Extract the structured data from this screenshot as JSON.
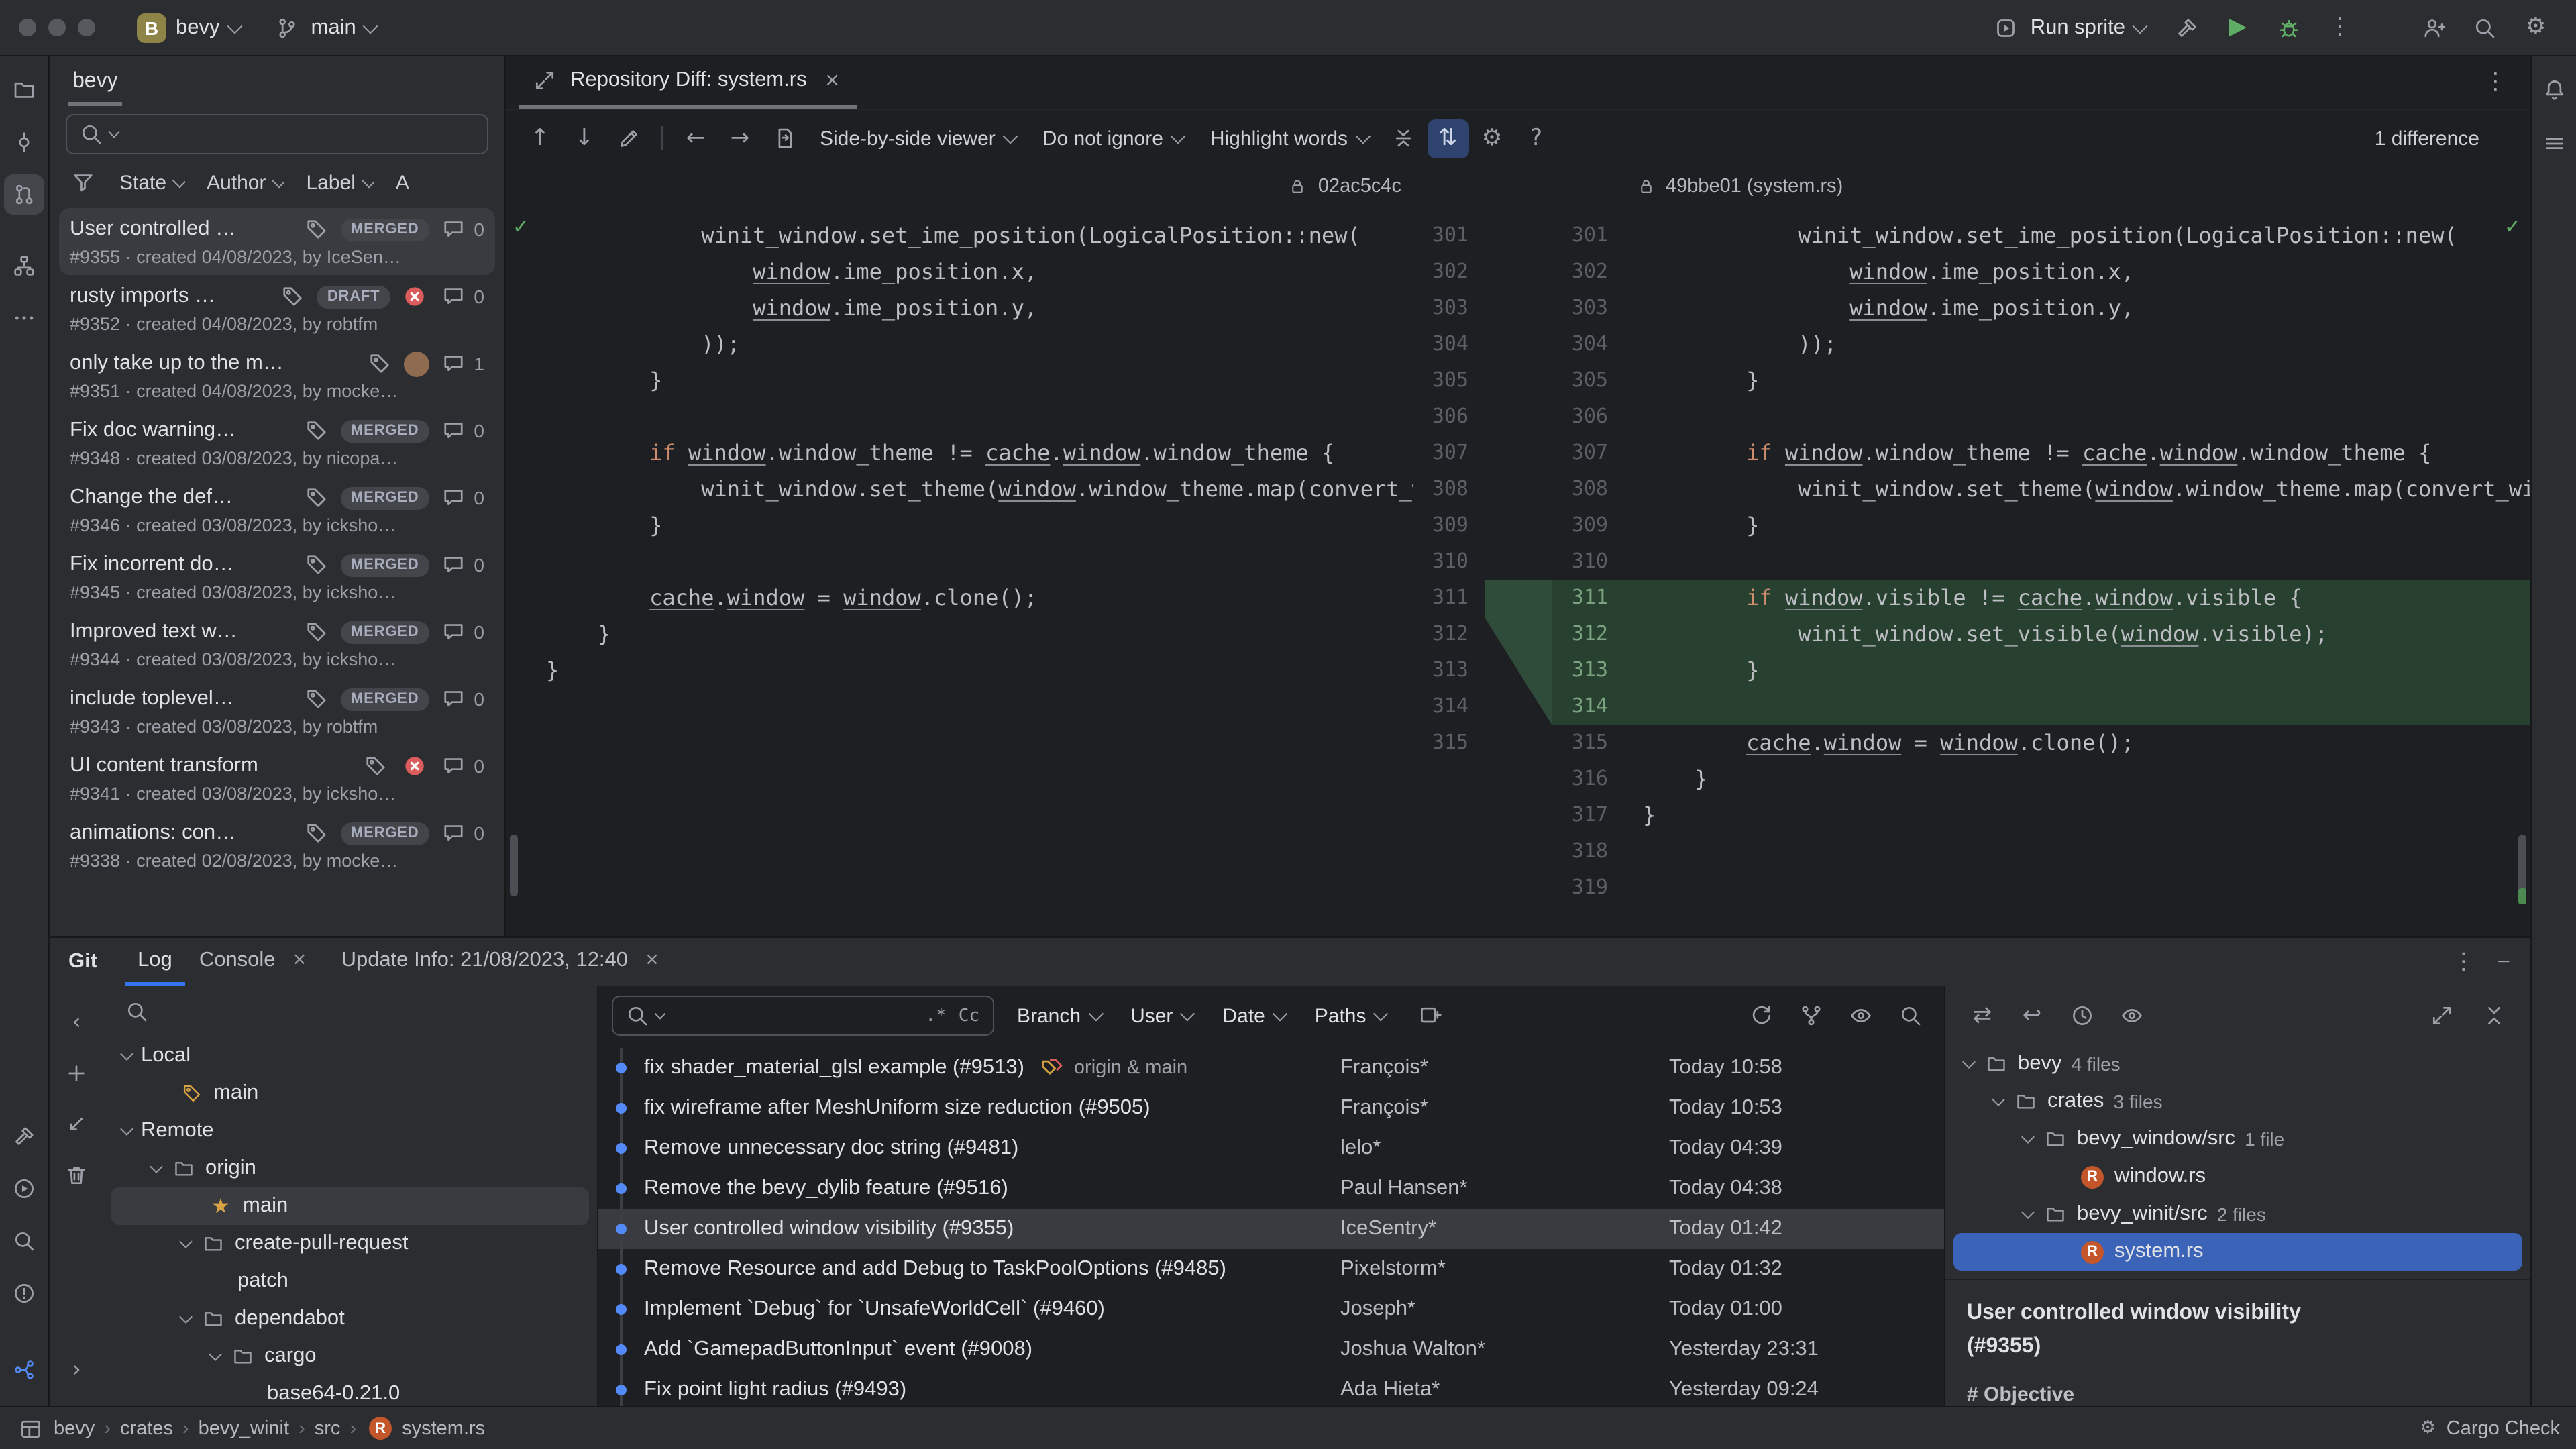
{
  "colors": {
    "accent_blue": "#3574F0",
    "selection_focused": "#3B63B8",
    "selection_unfocused": "#393B40",
    "diff_added_bg": "#28402F",
    "run_green": "#5FAD65",
    "error_red": "#DB5C5C",
    "star_yellow": "#D9A343"
  },
  "topbar": {
    "project": "bevy",
    "project_initial": "B",
    "branch": "main",
    "run_config": "Run sprite"
  },
  "left_stripe": {
    "top": [
      {
        "name": "project-icon",
        "active": false
      },
      {
        "name": "commit-icon",
        "active": false
      },
      {
        "name": "pull-requests-icon",
        "active": true
      },
      {
        "name": "structure-icon",
        "active": false,
        "extra": "mt14"
      },
      {
        "name": "more-tools-icon",
        "active": false
      }
    ],
    "bottom": [
      {
        "name": "build-icon"
      },
      {
        "name": "services-icon"
      },
      {
        "name": "find-icon"
      },
      {
        "name": "problems-icon"
      },
      {
        "name": "version-control-icon",
        "accent": true,
        "extra": "mt18"
      }
    ]
  },
  "right_stripe": [
    "notifications-icon",
    "right-stripe-icon"
  ],
  "pr_panel": {
    "tab_label": "bevy",
    "filters": [
      {
        "label": "State",
        "chevron": true
      },
      {
        "label": "Author",
        "chevron": true
      },
      {
        "label": "Label",
        "chevron": true
      },
      {
        "label": "A",
        "chevron": false
      }
    ],
    "items": [
      {
        "title": "User controlled …",
        "tag": true,
        "badge": "MERGED",
        "comments": "0",
        "meta": "#9355 · created 04/08/2023, by IceSen…",
        "selected": true
      },
      {
        "title": "rusty imports …",
        "tag": true,
        "badge": "DRAFT",
        "failed": true,
        "comments": "0",
        "meta": "#9352 · created 04/08/2023, by robtfm"
      },
      {
        "title": "only take up to the m…",
        "tag": true,
        "avatar": true,
        "comments": "1",
        "meta": "#9351 · created 04/08/2023, by mocke…"
      },
      {
        "title": "Fix doc warning…",
        "tag": true,
        "badge": "MERGED",
        "comments": "0",
        "meta": "#9348 · created 03/08/2023, by nicopa…"
      },
      {
        "title": "Change the def…",
        "tag": true,
        "badge": "MERGED",
        "comments": "0",
        "meta": "#9346 · created 03/08/2023, by icksho…"
      },
      {
        "title": "Fix incorrent do…",
        "tag": true,
        "badge": "MERGED",
        "comments": "0",
        "meta": "#9345 · created 03/08/2023, by icksho…"
      },
      {
        "title": "Improved text w…",
        "tag": true,
        "badge": "MERGED",
        "comments": "0",
        "meta": "#9344 · created 03/08/2023, by icksho…"
      },
      {
        "title": "include toplevel…",
        "tag": true,
        "badge": "MERGED",
        "comments": "0",
        "meta": "#9343 · created 03/08/2023, by robtfm"
      },
      {
        "title": "UI content transform",
        "tag": true,
        "failed": true,
        "comments": "0",
        "meta": "#9341 · created 03/08/2023, by icksho…"
      },
      {
        "title": "animations: con…",
        "tag": true,
        "badge": "MERGED",
        "comments": "0",
        "meta": "#9338 · created 02/08/2023, by mocke…"
      }
    ]
  },
  "diff": {
    "tab_title": "Repository Diff: system.rs",
    "toolbar": [
      {
        "icon": "previous-difference-icon"
      },
      {
        "icon": "next-difference-icon"
      },
      {
        "icon": "edit-source-icon"
      },
      {
        "sep": true
      },
      {
        "icon": "previous-file-icon"
      },
      {
        "icon": "next-file-icon"
      },
      {
        "icon": "go-to-changed-file-icon"
      },
      {
        "dropdown": "Side-by-side viewer"
      },
      {
        "dropdown": "Do not ignore"
      },
      {
        "dropdown": "Highlight words"
      },
      {
        "icon": "collapse-unchanged-icon"
      },
      {
        "icon": "synchronize-scrolling-icon",
        "active": true
      },
      {
        "icon": "diff-settings-icon"
      },
      {
        "icon": "help-icon"
      }
    ],
    "difference_label": "1 difference",
    "left_title": "02ac5c4c",
    "right_title": "49bbe01 (system.rs)",
    "left_lines": [
      {
        "n": "301",
        "t": "            winit_window.set_ime_position(LogicalPosition::new("
      },
      {
        "n": "302",
        "t": "                window.ime_position.x,"
      },
      {
        "n": "303",
        "t": "                window.ime_position.y,"
      },
      {
        "n": "304",
        "t": "            ));"
      },
      {
        "n": "305",
        "t": "        }"
      },
      {
        "n": "306",
        "t": ""
      },
      {
        "n": "307",
        "t": "        if window.window_theme != cache.window.window_theme {"
      },
      {
        "n": "308",
        "t": "            winit_window.set_theme(window.window_theme.map(convert_window_theme));"
      },
      {
        "n": "309",
        "t": "        }"
      },
      {
        "n": "310",
        "t": ""
      },
      {
        "n": "311",
        "t": "        cache.window = window.clone();"
      },
      {
        "n": "312",
        "t": "    }"
      },
      {
        "n": "313",
        "t": "}"
      },
      {
        "n": "314",
        "t": ""
      },
      {
        "n": "315",
        "t": ""
      }
    ],
    "right_lines": [
      {
        "n": "301",
        "t": "            winit_window.set_ime_position(LogicalPosition::new("
      },
      {
        "n": "302",
        "t": "                window.ime_position.x,"
      },
      {
        "n": "303",
        "t": "                window.ime_position.y,"
      },
      {
        "n": "304",
        "t": "            ));"
      },
      {
        "n": "305",
        "t": "        }"
      },
      {
        "n": "306",
        "t": ""
      },
      {
        "n": "307",
        "t": "        if window.window_theme != cache.window.window_theme {"
      },
      {
        "n": "308",
        "t": "            winit_window.set_theme(window.window_theme.map(convert_window_theme));"
      },
      {
        "n": "309",
        "t": "        }"
      },
      {
        "n": "310",
        "t": ""
      },
      {
        "n": "311",
        "t": "        if window.visible != cache.window.visible {",
        "added": true
      },
      {
        "n": "312",
        "t": "            winit_window.set_visible(window.visible);",
        "added": true
      },
      {
        "n": "313",
        "t": "        }",
        "added": true
      },
      {
        "n": "314",
        "t": "",
        "added": true
      },
      {
        "n": "315",
        "t": "        cache.window = window.clone();"
      },
      {
        "n": "316",
        "t": "    }"
      },
      {
        "n": "317",
        "t": "}"
      },
      {
        "n": "318",
        "t": ""
      },
      {
        "n": "319",
        "t": ""
      }
    ]
  },
  "git_panel": {
    "window_title": "Git",
    "tabs": [
      {
        "label": "Log",
        "selected": true
      },
      {
        "label": "Console",
        "closable": true
      },
      {
        "label": "Update Info: 21/08/2023, 12:40",
        "closable": true
      }
    ],
    "branches_toolbar": [
      "hide-panel-icon",
      "new-branch-icon",
      "update-branch-icon",
      "delete-branch-icon",
      "expand-panel-icon"
    ],
    "branches": [
      {
        "label": "Local",
        "indent": 0,
        "expanded": true
      },
      {
        "label": "main",
        "indent": 1,
        "icon": "current-branch-icon"
      },
      {
        "label": "Remote",
        "indent": 0,
        "expanded": true
      },
      {
        "label": "origin",
        "indent": 1,
        "expanded": true,
        "icon": "folder-icon"
      },
      {
        "label": "main",
        "indent": 2,
        "icon": "favorite-star-icon",
        "selected": true
      },
      {
        "label": "create-pull-request",
        "indent": 2,
        "expanded": true,
        "icon": "folder-icon"
      },
      {
        "label": "patch",
        "indent": 3
      },
      {
        "label": "dependabot",
        "indent": 2,
        "expanded": true,
        "icon": "folder-icon"
      },
      {
        "label": "cargo",
        "indent": 3,
        "expanded": true,
        "icon": "folder-icon"
      },
      {
        "label": "base64-0.21.0",
        "indent": 4
      }
    ],
    "log_toolbar": {
      "regex_label": ".*",
      "match_case_label": "Cc",
      "filters": [
        {
          "label": "Branch"
        },
        {
          "label": "User"
        },
        {
          "label": "Date"
        },
        {
          "label": "Paths"
        }
      ],
      "right_icons": [
        "refresh-icon",
        "branch-graph-icon",
        "view-options-icon",
        "find-commit-icon"
      ]
    },
    "commits": [
      {
        "message": "fix shader_material_glsl example (#9513)",
        "refs": "origin & main",
        "author": "François*",
        "date": "Today 10:58"
      },
      {
        "message": "fix wireframe after MeshUniform size reduction (#9505)",
        "author": "François*",
        "date": "Today 10:53"
      },
      {
        "message": "Remove unnecessary doc string (#9481)",
        "author": "lelo*",
        "date": "Today 04:39"
      },
      {
        "message": "Remove the bevy_dylib feature (#9516)",
        "author": "Paul Hansen*",
        "date": "Today 04:38"
      },
      {
        "message": "User controlled window visibility (#9355)",
        "author": "IceSentry*",
        "date": "Today 01:42",
        "selected": true
      },
      {
        "message": "Remove Resource and add Debug to TaskPoolOptions (#9485)",
        "author": "Pixelstorm*",
        "date": "Today 01:32"
      },
      {
        "message": "Implement `Debug` for `UnsafeWorldCell` (#9460)",
        "author": "Joseph*",
        "date": "Today 01:00"
      },
      {
        "message": "Add `GamepadButtonInput` event (#9008)",
        "author": "Joshua Walton*",
        "date": "Yesterday 23:31"
      },
      {
        "message": "Fix point light radius (#9493)",
        "author": "Ada Hieta*",
        "date": "Yesterday 09:24"
      }
    ],
    "details": {
      "toolbar_icons": [
        "compare-icon",
        "rollback-icon",
        "history-icon",
        "preview-icon"
      ],
      "window_icons": [
        "expand-details-icon",
        "hide-details-icon"
      ],
      "files": [
        {
          "label": "bevy",
          "badge": "4 files",
          "indent": 0,
          "icon": "folder-icon",
          "expanded": true
        },
        {
          "label": "crates",
          "badge": "3 files",
          "indent": 1,
          "icon": "folder-icon",
          "expanded": true
        },
        {
          "label": "bevy_window/src",
          "badge": "1 file",
          "indent": 2,
          "icon": "folder-icon",
          "expanded": true
        },
        {
          "label": "window.rs",
          "indent": 3,
          "icon": "rust-file-icon"
        },
        {
          "label": "bevy_winit/src",
          "badge": "2 files",
          "indent": 2,
          "icon": "folder-icon",
          "expanded": true
        },
        {
          "label": "system.rs",
          "indent": 3,
          "icon": "rust-file-icon",
          "selected": true
        }
      ],
      "commit_title": "User controlled window visibility (#9355)",
      "commit_body_preview": "# Objective"
    }
  },
  "statusbar": {
    "breadcrumbs": [
      "bevy",
      "crates",
      "bevy_winit",
      "src",
      "system.rs"
    ],
    "right_label": "Cargo Check"
  }
}
